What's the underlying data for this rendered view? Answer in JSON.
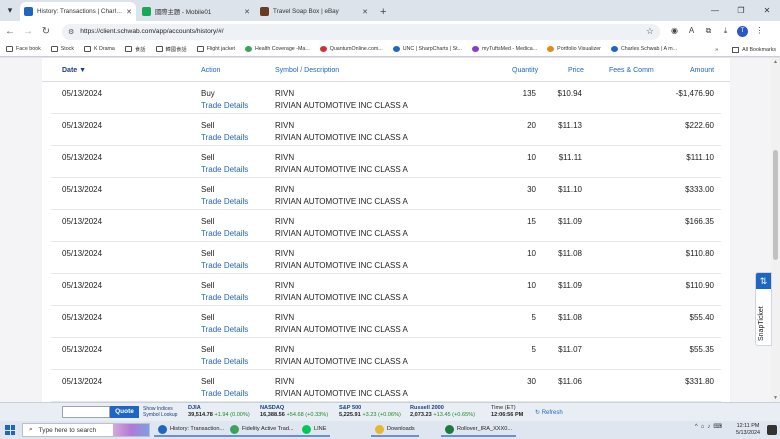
{
  "tabs": [
    {
      "label": "History: Transactions | Charles Sch",
      "color": "#1f66c1",
      "active": true
    },
    {
      "label": "國際主題 - Mobile01",
      "color": "#18a85a",
      "active": false
    },
    {
      "label": "Travel Soap Box | eBay",
      "color": "#6b3a1f",
      "active": false
    }
  ],
  "tab_close": "✕",
  "new_tab": "+",
  "window_controls": [
    "—",
    "❐",
    "✕"
  ],
  "address": {
    "url": "https://client.schwab.com/app/accounts/history/#/"
  },
  "profile_initial": "T",
  "bookmarks": [
    {
      "label": "Face book",
      "color": ""
    },
    {
      "label": "Stock",
      "color": ""
    },
    {
      "label": "K Drama",
      "color": ""
    },
    {
      "label": "食話",
      "color": ""
    },
    {
      "label": "韓國食話",
      "color": ""
    },
    {
      "label": "Flight jacket",
      "color": ""
    },
    {
      "label": "Health Coverage -Ma...",
      "color": "#3aa45c"
    },
    {
      "label": "QuantumOnline.com...",
      "color": "#c33"
    },
    {
      "label": "UNC | SharpCharts | St...",
      "color": "#1f66c1"
    },
    {
      "label": "myTuftsMed - Medica...",
      "color": "#8a3ac8"
    },
    {
      "label": "Portfolio Visualizer",
      "color": "#e08a1f"
    },
    {
      "label": "Charles Schwab | A m...",
      "color": "#1f66c1"
    }
  ],
  "all_bookmarks": "All Bookmarks",
  "table": {
    "headers": {
      "date": "Date ▼",
      "action": "Action",
      "symbol": "Symbol / Description",
      "quantity": "Quantity",
      "price": "Price",
      "fees": "Fees & Comm",
      "amount": "Amount"
    },
    "trade_details": "Trade Details",
    "rows": [
      {
        "date": "05/13/2024",
        "action": "Buy",
        "symbol": "RIVN",
        "description": "RIVIAN AUTOMOTIVE INC CLASS A",
        "quantity": "135",
        "price": "$10.94",
        "amount": "-$1,476.90"
      },
      {
        "date": "05/13/2024",
        "action": "Sell",
        "symbol": "RIVN",
        "description": "RIVIAN AUTOMOTIVE INC CLASS A",
        "quantity": "20",
        "price": "$11.13",
        "amount": "$222.60"
      },
      {
        "date": "05/13/2024",
        "action": "Sell",
        "symbol": "RIVN",
        "description": "RIVIAN AUTOMOTIVE INC CLASS A",
        "quantity": "10",
        "price": "$11.11",
        "amount": "$111.10"
      },
      {
        "date": "05/13/2024",
        "action": "Sell",
        "symbol": "RIVN",
        "description": "RIVIAN AUTOMOTIVE INC CLASS A",
        "quantity": "30",
        "price": "$11.10",
        "amount": "$333.00"
      },
      {
        "date": "05/13/2024",
        "action": "Sell",
        "symbol": "RIVN",
        "description": "RIVIAN AUTOMOTIVE INC CLASS A",
        "quantity": "15",
        "price": "$11.09",
        "amount": "$166.35"
      },
      {
        "date": "05/13/2024",
        "action": "Sell",
        "symbol": "RIVN",
        "description": "RIVIAN AUTOMOTIVE INC CLASS A",
        "quantity": "10",
        "price": "$11.08",
        "amount": "$110.80"
      },
      {
        "date": "05/13/2024",
        "action": "Sell",
        "symbol": "RIVN",
        "description": "RIVIAN AUTOMOTIVE INC CLASS A",
        "quantity": "10",
        "price": "$11.09",
        "amount": "$110.90"
      },
      {
        "date": "05/13/2024",
        "action": "Sell",
        "symbol": "RIVN",
        "description": "RIVIAN AUTOMOTIVE INC CLASS A",
        "quantity": "5",
        "price": "$11.08",
        "amount": "$55.40"
      },
      {
        "date": "05/13/2024",
        "action": "Sell",
        "symbol": "RIVN",
        "description": "RIVIAN AUTOMOTIVE INC CLASS A",
        "quantity": "5",
        "price": "$11.07",
        "amount": "$55.35"
      },
      {
        "date": "05/13/2024",
        "action": "Sell",
        "symbol": "RIVN",
        "description": "RIVIAN AUTOMOTIVE INC CLASS A",
        "quantity": "30",
        "price": "$11.06",
        "amount": "$331.80"
      }
    ]
  },
  "snap_ticket": {
    "label": "SnapTicket",
    "icon": "⇅"
  },
  "ticker": {
    "quote_button": "Quote",
    "show_indices": "Show Indices",
    "symbol_lookup": "Symbol Lookup",
    "indices": [
      {
        "name": "DJIA",
        "value": "39,514.78",
        "change": "+1.94 (0.00%)"
      },
      {
        "name": "NASDAQ",
        "value": "16,388.56",
        "change": "+54.68 (+0.33%)"
      },
      {
        "name": "S&P 500",
        "value": "5,225.91",
        "change": "+3.23 (+0.06%)"
      },
      {
        "name": "Russell 2000",
        "value": "2,073.23",
        "change": "+13.45 (+0.65%)"
      }
    ],
    "time_label": "Time (ET)",
    "time_value": "12:06:56 PM",
    "refresh": "Refresh",
    "positive_color": "#1a8a2a"
  },
  "taskbar": {
    "search_placeholder": "Type here to search",
    "apps": [
      {
        "label": "History: Transaction...",
        "color": "#1f66c1"
      },
      {
        "label": "Fidelity Active Trad...",
        "color": "#3aa45c"
      },
      {
        "label": "LINE",
        "color": "#06c755"
      },
      {
        "label": "Downloads",
        "color": "#e8b730"
      },
      {
        "label": "Rollover_IRA_XXX0...",
        "color": "#1e7a3c"
      }
    ],
    "time": "12:11 PM",
    "date": "5/13/2024"
  }
}
